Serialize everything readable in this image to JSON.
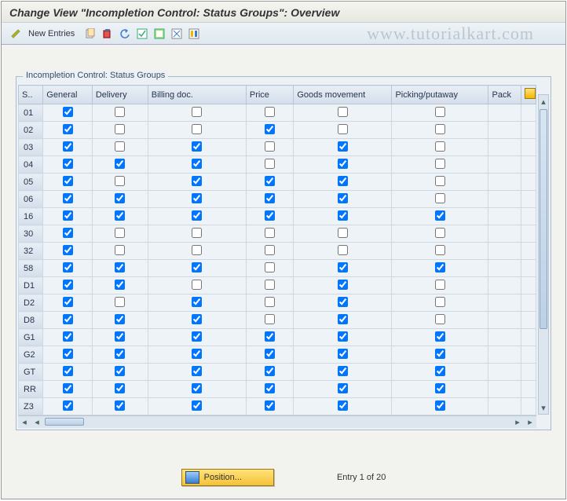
{
  "header": {
    "title": "Change View \"Incompletion Control: Status Groups\": Overview"
  },
  "toolbar": {
    "new_entries": "New Entries"
  },
  "watermark": "www.tutorialkart.com",
  "panel": {
    "caption": "Incompletion Control: Status Groups",
    "columns": [
      "S..",
      "General",
      "Delivery",
      "Billing doc.",
      "Price",
      "Goods movement",
      "Picking/putaway",
      "Pack"
    ]
  },
  "rows": [
    {
      "code": "01",
      "general": true,
      "delivery": false,
      "billing": false,
      "price": false,
      "goods": false,
      "picking": false
    },
    {
      "code": "02",
      "general": true,
      "delivery": false,
      "billing": false,
      "price": true,
      "goods": false,
      "picking": false
    },
    {
      "code": "03",
      "general": true,
      "delivery": false,
      "billing": true,
      "price": false,
      "goods": true,
      "picking": false
    },
    {
      "code": "04",
      "general": true,
      "delivery": true,
      "billing": true,
      "price": false,
      "goods": true,
      "picking": false
    },
    {
      "code": "05",
      "general": true,
      "delivery": false,
      "billing": true,
      "price": true,
      "goods": true,
      "picking": false
    },
    {
      "code": "06",
      "general": true,
      "delivery": true,
      "billing": true,
      "price": true,
      "goods": true,
      "picking": false
    },
    {
      "code": "16",
      "general": true,
      "delivery": true,
      "billing": true,
      "price": true,
      "goods": true,
      "picking": true
    },
    {
      "code": "30",
      "general": true,
      "delivery": false,
      "billing": false,
      "price": false,
      "goods": false,
      "picking": false
    },
    {
      "code": "32",
      "general": true,
      "delivery": false,
      "billing": false,
      "price": false,
      "goods": false,
      "picking": false
    },
    {
      "code": "58",
      "general": true,
      "delivery": true,
      "billing": true,
      "price": false,
      "goods": true,
      "picking": true
    },
    {
      "code": "D1",
      "general": true,
      "delivery": true,
      "billing": false,
      "price": false,
      "goods": true,
      "picking": false
    },
    {
      "code": "D2",
      "general": true,
      "delivery": false,
      "billing": true,
      "price": false,
      "goods": true,
      "picking": false
    },
    {
      "code": "D8",
      "general": true,
      "delivery": true,
      "billing": true,
      "price": false,
      "goods": true,
      "picking": false
    },
    {
      "code": "G1",
      "general": true,
      "delivery": true,
      "billing": true,
      "price": true,
      "goods": true,
      "picking": true
    },
    {
      "code": "G2",
      "general": true,
      "delivery": true,
      "billing": true,
      "price": true,
      "goods": true,
      "picking": true
    },
    {
      "code": "GT",
      "general": true,
      "delivery": true,
      "billing": true,
      "price": true,
      "goods": true,
      "picking": true
    },
    {
      "code": "RR",
      "general": true,
      "delivery": true,
      "billing": true,
      "price": true,
      "goods": true,
      "picking": true
    },
    {
      "code": "Z3",
      "general": true,
      "delivery": true,
      "billing": true,
      "price": true,
      "goods": true,
      "picking": true
    }
  ],
  "footer": {
    "position_label": "Position...",
    "entry_text": "Entry 1 of 20"
  }
}
